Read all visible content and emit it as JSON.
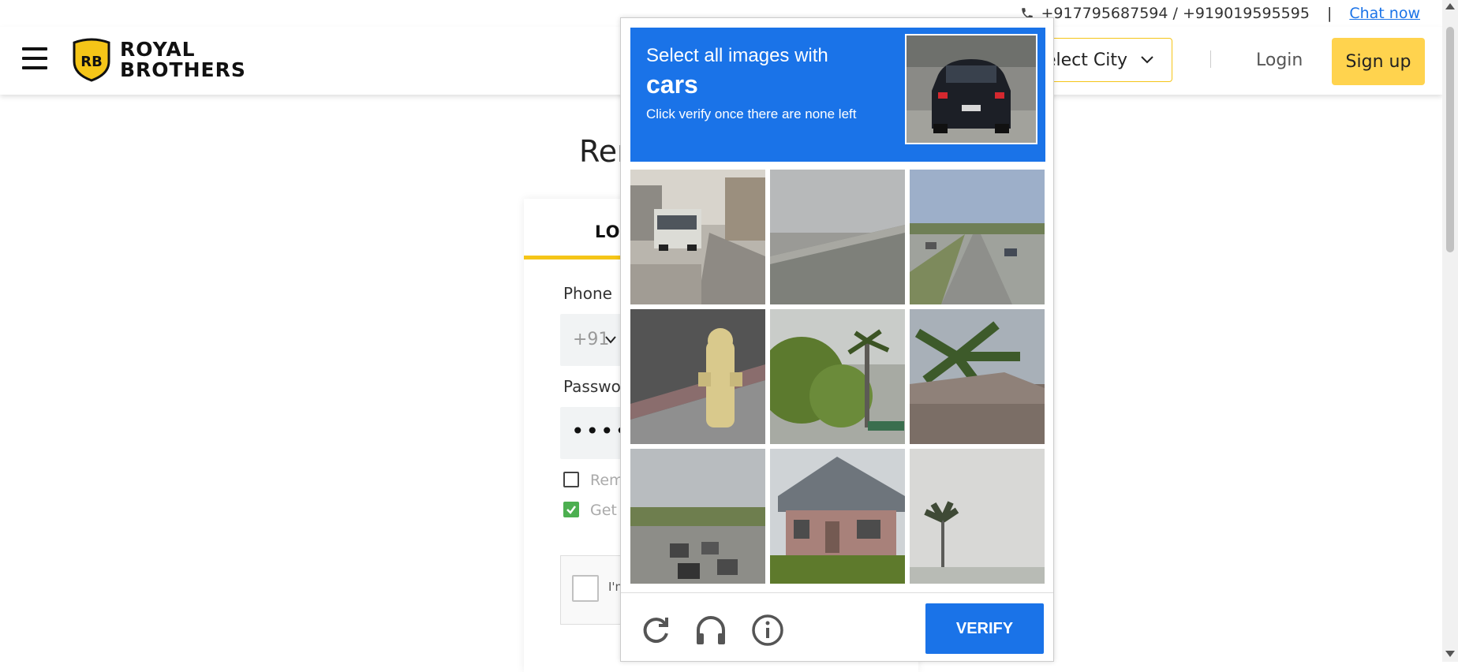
{
  "topbar": {
    "phones": "+917795687594 / +919019595595",
    "separator": "|",
    "chat_label": "Chat now"
  },
  "header": {
    "logo_line1": "ROYAL",
    "logo_line2": "BROTHERS",
    "logo_badge": "RB",
    "city_select": "elect City",
    "login_label": "Login",
    "signup_label": "Sign up"
  },
  "page": {
    "heading_partial": "Ren",
    "tab_login": "LOG",
    "phone_label": "Phone",
    "country_code": "+91",
    "password_label": "Passwo",
    "password_masked": "•••••",
    "remember_label": "Rem",
    "get_label": "Get",
    "recaptcha_label": "I'm"
  },
  "captcha": {
    "instruction_line1": "Select all images with",
    "target_word": "cars",
    "instruction_line3": "Click verify once there are none left",
    "verify_label": "VERIFY",
    "tiles": [
      {
        "name": "tile-street-bus"
      },
      {
        "name": "tile-highway-noisy"
      },
      {
        "name": "tile-highway-cars"
      },
      {
        "name": "tile-fire-hydrant"
      },
      {
        "name": "tile-trees-sign"
      },
      {
        "name": "tile-palm-roof"
      },
      {
        "name": "tile-cars-traffic"
      },
      {
        "name": "tile-house"
      },
      {
        "name": "tile-palm-sky"
      }
    ]
  },
  "colors": {
    "accent_blue": "#1a73e8",
    "brand_yellow": "#ffd34e",
    "check_green": "#4caf50"
  }
}
